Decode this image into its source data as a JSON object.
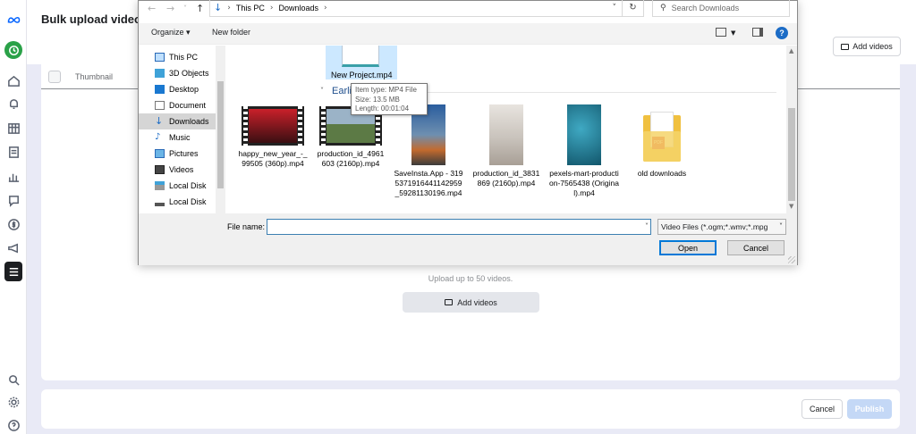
{
  "app": {
    "title": "Bulk upload videos",
    "add_videos_top": "Add videos",
    "table_header_thumbnail": "Thumbnail",
    "upload_hint": "Upload up to 50 videos.",
    "add_videos_main": "Add videos",
    "cancel": "Cancel",
    "publish": "Publish",
    "rail_icons": [
      "meta-logo-icon",
      "clock-icon",
      "home-icon",
      "bell-icon",
      "calendar-icon",
      "content-icon",
      "insights-icon",
      "chat-icon",
      "dollar-icon",
      "megaphone-icon",
      "menu-icon",
      "search-icon",
      "settings-icon",
      "help-icon"
    ]
  },
  "dialog": {
    "breadcrumb": [
      "This PC",
      "Downloads"
    ],
    "search_placeholder": "Search Downloads",
    "toolbar": {
      "organize": "Organize ▾",
      "new_folder": "New folder"
    },
    "nav_items": [
      {
        "label": "This PC",
        "icon": "pc-icon"
      },
      {
        "label": "3D Objects",
        "icon": "cube-icon"
      },
      {
        "label": "Desktop",
        "icon": "desktop-icon"
      },
      {
        "label": "Document",
        "icon": "document-icon"
      },
      {
        "label": "Downloads",
        "icon": "download-icon",
        "selected": true
      },
      {
        "label": "Music",
        "icon": "music-icon"
      },
      {
        "label": "Pictures",
        "icon": "pictures-icon"
      },
      {
        "label": "Videos",
        "icon": "videos-icon"
      },
      {
        "label": "Local Disk",
        "icon": "disk-icon"
      },
      {
        "label": "Local Disk",
        "icon": "disk-icon"
      }
    ],
    "selected_file": "New Project.mp4",
    "group_header": "Earli",
    "tooltip": {
      "item_type": "Item type: MP4 File",
      "size": "Size: 13.5 MB",
      "length": "Length: 00:01:04"
    },
    "files": [
      {
        "name": "happy_new_year_-_99505 (360p).mp4",
        "kind": "film",
        "color": "#8b1d22"
      },
      {
        "name": "production_id_4961603 (2160p).mp4",
        "kind": "film",
        "color": "#5c7a45"
      },
      {
        "name": "SaveInsta.App - 3195371916441142959_59281130196.mp4",
        "kind": "portrait",
        "color": "#3a5f8c"
      },
      {
        "name": "production_id_3831869 (2160p).mp4",
        "kind": "portrait",
        "color": "#cfcac4"
      },
      {
        "name": "pexels-mart-production-7565438 (Original).mp4",
        "kind": "portrait",
        "color": "#1e6f86"
      },
      {
        "name": "old downloads",
        "kind": "folder",
        "color": "#f0c040"
      }
    ],
    "file_name_label": "File name:",
    "file_name_value": "",
    "file_type": "Video Files (*.ogm;*.wmv;*.mpg",
    "open": "Open",
    "cancel": "Cancel"
  }
}
